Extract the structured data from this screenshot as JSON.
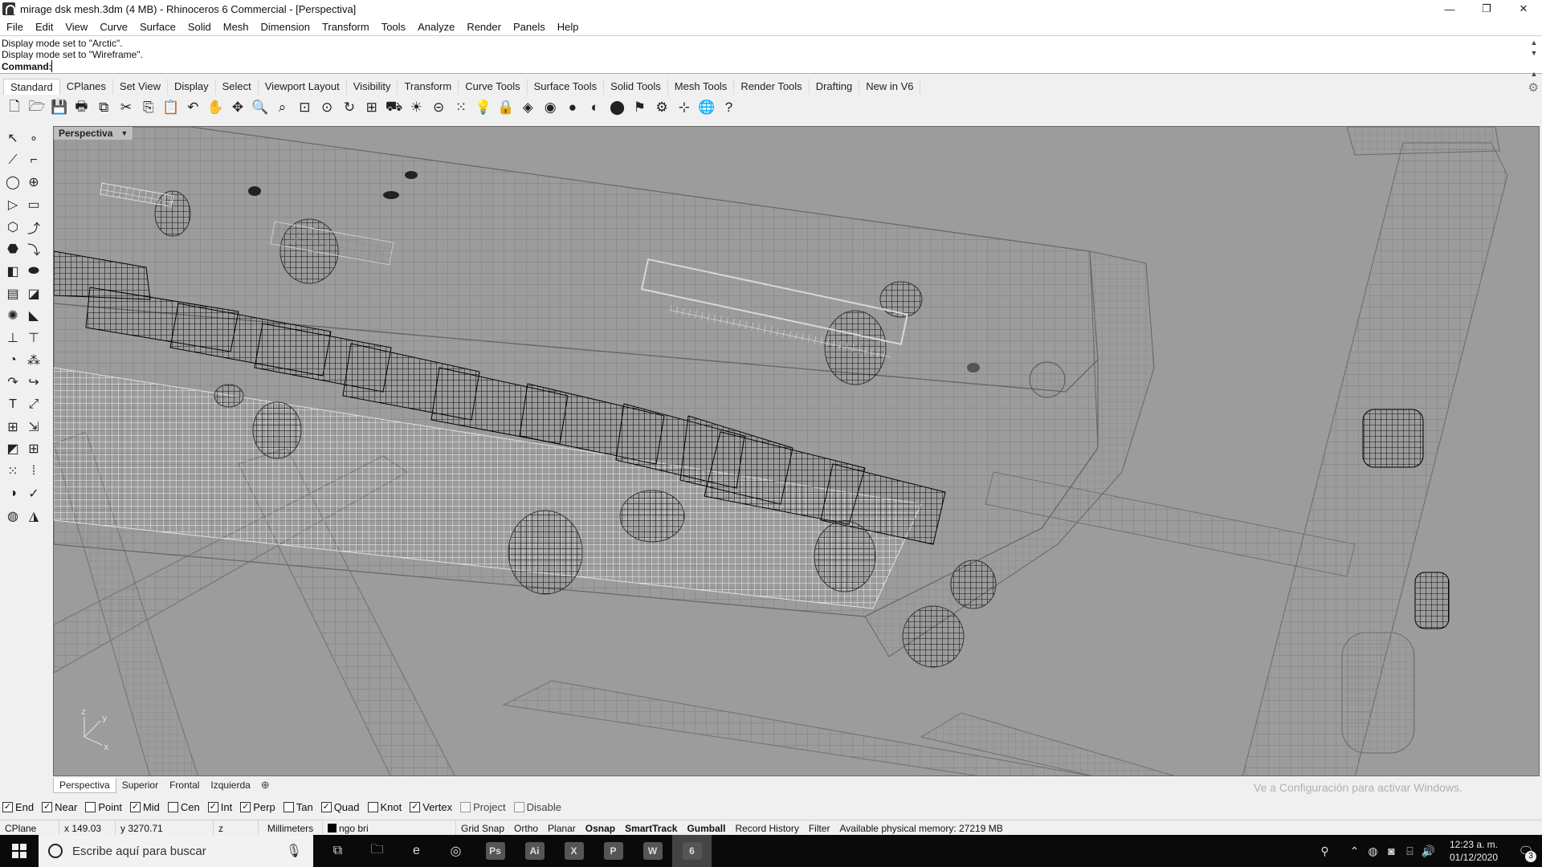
{
  "window": {
    "title": "mirage dsk mesh.3dm (4 MB) - Rhinoceros 6 Commercial - [Perspectiva]",
    "controls": {
      "minimize": "—",
      "restore": "❐",
      "close": "✕"
    }
  },
  "menu": [
    "File",
    "Edit",
    "View",
    "Curve",
    "Surface",
    "Solid",
    "Mesh",
    "Dimension",
    "Transform",
    "Tools",
    "Analyze",
    "Render",
    "Panels",
    "Help"
  ],
  "command": {
    "history": [
      "Display mode set to \"Arctic\".",
      "Display mode set to \"Wireframe\"."
    ],
    "label": "Command:",
    "value": ""
  },
  "toolbar_tabs": [
    "Standard",
    "CPlanes",
    "Set View",
    "Display",
    "Select",
    "Viewport Layout",
    "Visibility",
    "Transform",
    "Curve Tools",
    "Surface Tools",
    "Solid Tools",
    "Mesh Tools",
    "Render Tools",
    "Drafting",
    "New in V6"
  ],
  "toolbar_tools": [
    {
      "name": "new-icon",
      "glyph": "🗋"
    },
    {
      "name": "open-icon",
      "glyph": "🗁"
    },
    {
      "name": "save-icon",
      "glyph": "💾"
    },
    {
      "name": "print-icon",
      "glyph": "🖶"
    },
    {
      "name": "copy-to-clipboard-icon",
      "glyph": "⧉"
    },
    {
      "name": "cut-icon",
      "glyph": "✂"
    },
    {
      "name": "copy-icon",
      "glyph": "⎘"
    },
    {
      "name": "paste-icon",
      "glyph": "📋"
    },
    {
      "name": "undo-icon",
      "glyph": "↶"
    },
    {
      "name": "pan-hand-icon",
      "glyph": "✋"
    },
    {
      "name": "move-view-icon",
      "glyph": "✥"
    },
    {
      "name": "zoom-icon",
      "glyph": "🔍"
    },
    {
      "name": "zoom-window-icon",
      "glyph": "⌕"
    },
    {
      "name": "zoom-extents-icon",
      "glyph": "⊡"
    },
    {
      "name": "zoom-selected-icon",
      "glyph": "⊙"
    },
    {
      "name": "rotate-view-icon",
      "glyph": "↻"
    },
    {
      "name": "four-viewports-icon",
      "glyph": "⊞"
    },
    {
      "name": "car-icon",
      "glyph": "⛟"
    },
    {
      "name": "light-icon",
      "glyph": "☀"
    },
    {
      "name": "cplane-icon",
      "glyph": "⊝"
    },
    {
      "name": "points-icon",
      "glyph": "⁙"
    },
    {
      "name": "bulb-icon",
      "glyph": "💡"
    },
    {
      "name": "lock-icon",
      "glyph": "🔒"
    },
    {
      "name": "material-icon",
      "glyph": "◈"
    },
    {
      "name": "render-sphere-icon",
      "glyph": "◉"
    },
    {
      "name": "shaded-sphere-icon",
      "glyph": "●"
    },
    {
      "name": "ghosted-sphere-icon",
      "glyph": "◐"
    },
    {
      "name": "rendered-sphere-icon",
      "glyph": "⬤"
    },
    {
      "name": "flamingo-icon",
      "glyph": "⚑"
    },
    {
      "name": "options-gear-icon",
      "glyph": "⚙"
    },
    {
      "name": "grid-snap-tool-icon",
      "glyph": "⊹"
    },
    {
      "name": "globe-icon",
      "glyph": "🌐"
    },
    {
      "name": "help-icon",
      "glyph": "?"
    }
  ],
  "left_tools": [
    [
      "↖",
      "∘"
    ],
    [
      "⟋",
      "⌐"
    ],
    [
      "◯",
      "⊕"
    ],
    [
      "▷",
      "▭"
    ],
    [
      "⬡",
      "⤴"
    ],
    [
      "⬣",
      "⤵"
    ],
    [
      "◧",
      "⬬"
    ],
    [
      "▤",
      "◪"
    ],
    [
      "✺",
      "◣"
    ],
    [
      "⊥",
      "⊤"
    ],
    [
      "◔",
      "⁂"
    ],
    [
      "↷",
      "↪"
    ],
    [
      "T",
      "⤢"
    ],
    [
      "⊞",
      "⇲"
    ],
    [
      "◩",
      "⊞"
    ],
    [
      "⁙",
      "⁞"
    ],
    [
      "◑",
      "✓"
    ],
    [
      "◍",
      "◮"
    ]
  ],
  "viewport": {
    "title": "Perspectiva",
    "dropdown": "▼"
  },
  "viewport_tabs": [
    "Perspectiva",
    "Superior",
    "Frontal",
    "Izquierda"
  ],
  "viewport_add": "⊕",
  "watermark": "Ve a Configuración para activar Windows.",
  "osnaps": [
    {
      "label": "End",
      "checked": true
    },
    {
      "label": "Near",
      "checked": true
    },
    {
      "label": "Point",
      "checked": false
    },
    {
      "label": "Mid",
      "checked": true
    },
    {
      "label": "Cen",
      "checked": false
    },
    {
      "label": "Int",
      "checked": true
    },
    {
      "label": "Perp",
      "checked": true
    },
    {
      "label": "Tan",
      "checked": false
    },
    {
      "label": "Quad",
      "checked": true
    },
    {
      "label": "Knot",
      "checked": false
    },
    {
      "label": "Vertex",
      "checked": true
    },
    {
      "label": "Project",
      "checked": false,
      "dim": true
    },
    {
      "label": "Disable",
      "checked": false,
      "dim": true
    }
  ],
  "status": {
    "cplane": "CPlane",
    "x": "x 149.03",
    "y": "y 3270.71",
    "z": "z",
    "units": "Millimeters",
    "layer": "ngo bri",
    "toggles": [
      {
        "label": "Grid Snap",
        "on": false
      },
      {
        "label": "Ortho",
        "on": false
      },
      {
        "label": "Planar",
        "on": false
      },
      {
        "label": "Osnap",
        "on": true
      },
      {
        "label": "SmartTrack",
        "on": true
      },
      {
        "label": "Gumball",
        "on": true
      },
      {
        "label": "Record History",
        "on": false
      },
      {
        "label": "Filter",
        "on": false
      }
    ],
    "memory": "Available physical memory: 27219 MB"
  },
  "taskbar": {
    "search_placeholder": "Escribe aquí para buscar",
    "apps": [
      {
        "name": "task-view-icon",
        "label": "⧉"
      },
      {
        "name": "file-explorer-icon",
        "label": "🗀"
      },
      {
        "name": "edge-icon",
        "label": "e"
      },
      {
        "name": "chrome-icon",
        "label": "◎"
      },
      {
        "name": "photoshop-icon",
        "label": "Ps"
      },
      {
        "name": "illustrator-icon",
        "label": "Ai"
      },
      {
        "name": "excel-icon",
        "label": "X"
      },
      {
        "name": "powerpoint-icon",
        "label": "P"
      },
      {
        "name": "word-icon",
        "label": "W"
      },
      {
        "name": "rhino-icon",
        "label": "6"
      }
    ],
    "time": "12:23 a. m.",
    "date": "01/12/2020",
    "notification_count": "3"
  }
}
